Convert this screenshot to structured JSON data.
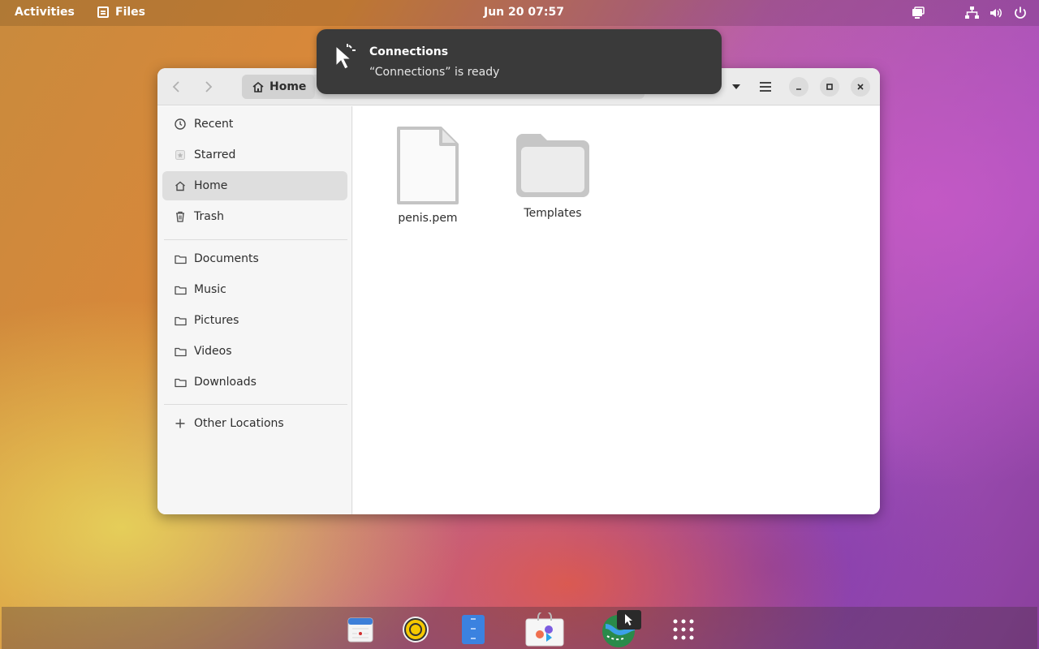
{
  "topbar": {
    "activities": "Activities",
    "app_name": "Files",
    "clock": "Jun 20  07:57"
  },
  "notification": {
    "title": "Connections",
    "body": "“Connections” is ready"
  },
  "window": {
    "path_home": "Home",
    "sidebar": {
      "places": [
        "Recent",
        "Starred",
        "Home",
        "Trash"
      ],
      "folders": [
        "Documents",
        "Music",
        "Pictures",
        "Videos",
        "Downloads"
      ],
      "other": "Other Locations",
      "active": "Home"
    },
    "files": [
      {
        "name": "penis.pem",
        "kind": "file-icon"
      },
      {
        "name": "Templates",
        "kind": "folder-icon"
      }
    ]
  },
  "dock": {
    "items": [
      "calendar-icon",
      "rhythmbox-icon",
      "text-editor-icon",
      "software-icon",
      "connections-icon",
      "show-apps-icon"
    ]
  },
  "colors": {
    "notification_bg": "#3a3a3a",
    "sidebar_active": "#dedede"
  }
}
